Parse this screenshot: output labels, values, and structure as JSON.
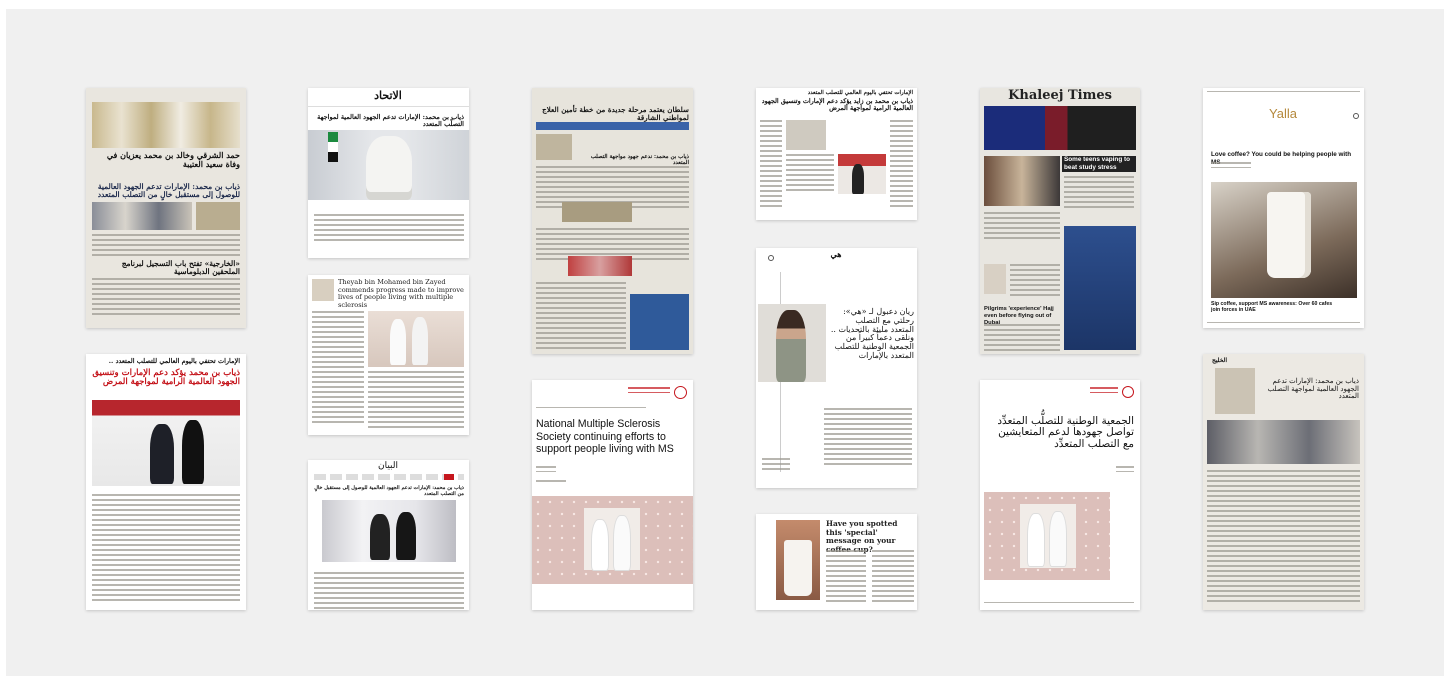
{
  "cards": {
    "c1": {
      "h1": "حمد الشرقي وخالد بن محمد يعزيان في وفاة سعيد العتيبة",
      "h2": "ذياب بن محمد: الإمارات تدعم الجهود العالمية للوصول إلى مستقبل خالٍ من التصلب المتعدد",
      "h3": "«الخارجية» تفتح باب التسجيل لبرنامج الملحقين الدبلوماسية"
    },
    "c2": {
      "masthead": "الاتحاد",
      "headline": "ذياب بن محمد: الإمارات تدعم الجهود العالمية لمواجهة التصلّب المتعدد"
    },
    "c3": {
      "headline": "Theyab bin Mohamed bin Zayed commends progress made to improve lives of people living with multiple sclerosis"
    },
    "c4": {
      "kicker": "الإمارات تحتفي باليوم العالمي للتصلب المتعدد ..",
      "headline": "ذياب بن محمد يؤكد دعم الإمارات وتنسيق الجهود العالمية الرامية لمواجهة المرض"
    },
    "c5": {
      "masthead": "البيان",
      "headline": "ذياب بن محمد: الإمارات تدعم الجهود العالمية للوصول إلى مستقبل خالٍ من التصلب المتعدد"
    },
    "c6": {
      "h1": "سلطان يعتمد مرحلة جديدة من خطة تأمين العلاج لمواطني الشارقة",
      "h2": "ذياب بن محمد: ندعم جهود مواجهة التصلب المتعدد"
    },
    "c7": {
      "headline": "National Multiple Sclerosis Society continuing efforts to support people living with MS"
    },
    "c8": {
      "kicker": "الإمارات تحتفي باليوم العالمي للتصلب المتعدد",
      "headline": "ذياب بن محمد بن زايد يؤكد دعم الإمارات وتنسيق الجهود العالمية الرامية لمواجهة المرض"
    },
    "c9": {
      "quote": "ريان دعبول لـ «هي»: رحلتي مع التصلب المتعدد مليئة بالتحديات .. ونلقى دعماً كبيراً من الجمعية الوطنية للتصلب المتعدد بالإمارات"
    },
    "c10": {
      "headline": "Have you spotted this 'special' message on your coffee cup?"
    },
    "c11": {
      "masthead": "Khaleej Times",
      "headline": "Some teens vaping to beat study stress",
      "sub1": "Pilgrims 'experience' Hajj even before flying out of Dubai"
    },
    "c12": {
      "headline": "الجمعية الوطنية للتصلُّب المتعدِّد تواصل جهودها لدعم المتعايشين مع التصلب المتعدِّد"
    },
    "c13": {
      "brand": "Yalla",
      "headline": "Love coffee? You could be helping people with MS",
      "caption": "Sip coffee, support MS awareness: Over 60 cafes join forces in UAE"
    },
    "c14": {
      "headline": "ذياب بن محمد: الإمارات تدعم الجهود العالمية لمواجهة التصلب المتعدد"
    }
  },
  "colors": {
    "board": "#f0f0f0",
    "brand_red": "#c5161d",
    "pink_bg": "#dcbfba"
  }
}
